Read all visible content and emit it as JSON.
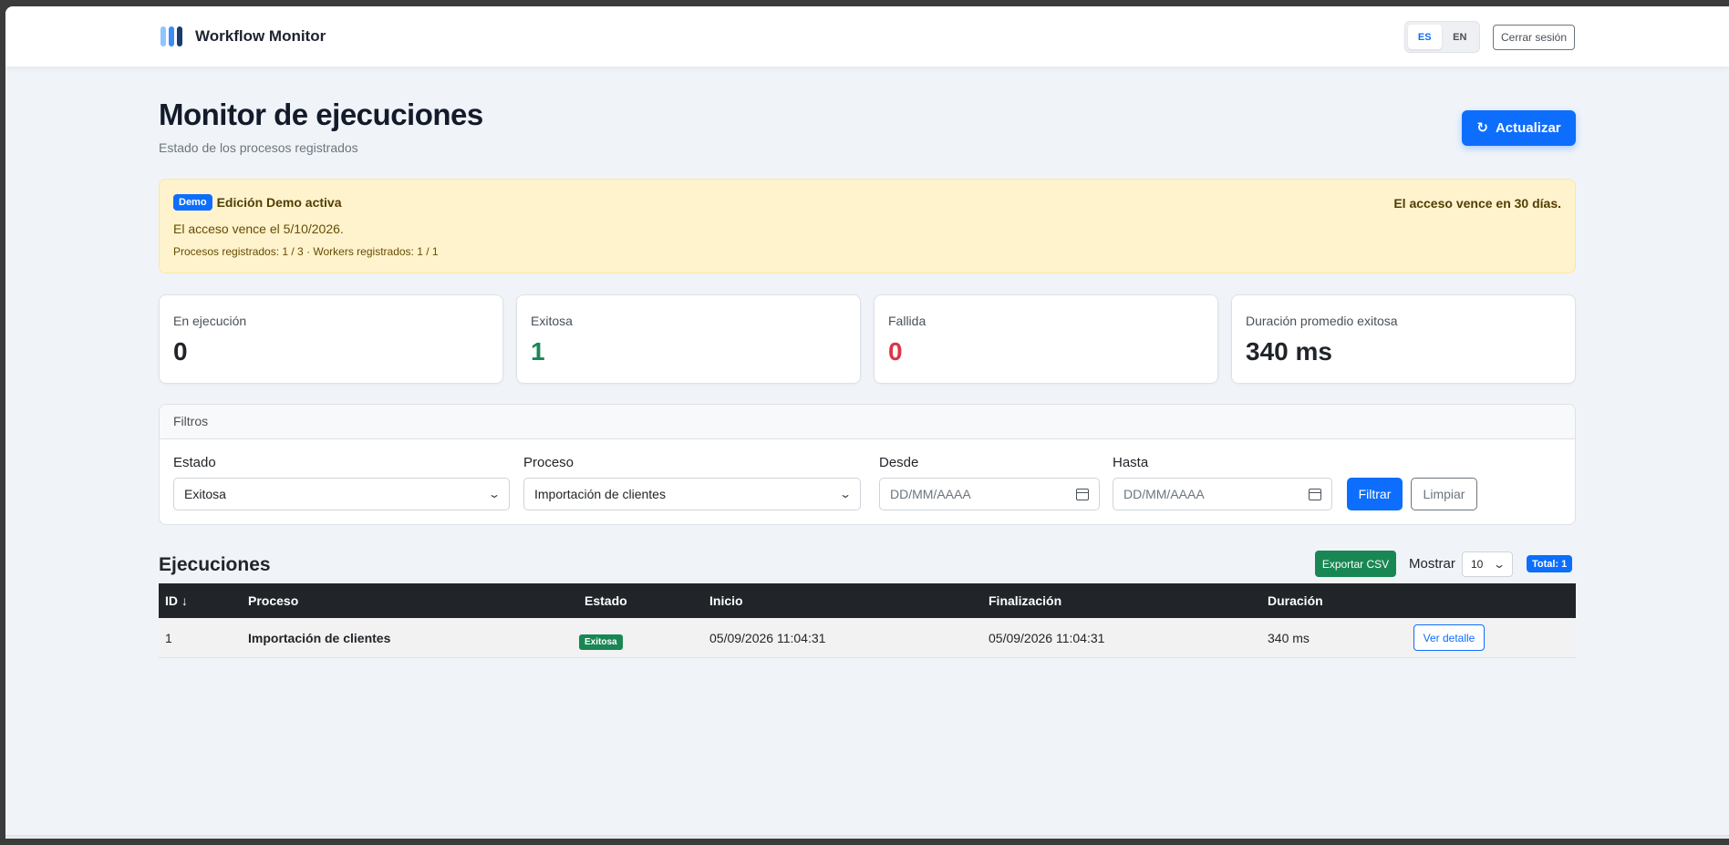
{
  "app": {
    "name": "Workflow Monitor"
  },
  "nav": {
    "languages": [
      {
        "code": "ES",
        "active": true
      },
      {
        "code": "EN",
        "active": false
      }
    ],
    "logout_label": "Cerrar sesión"
  },
  "page": {
    "title": "Monitor de ejecuciones",
    "subtitle": "Estado de los procesos registrados",
    "refresh_label": "Actualizar"
  },
  "demo": {
    "badge": "Demo",
    "title": "Edición Demo activa",
    "expires_in": "El acceso vence en 30 días.",
    "expiry_date_text": "El acceso vence el 5/10/2026.",
    "counts_text": "Procesos registrados: 1 / 3 · Workers registrados: 1 / 1"
  },
  "stats": [
    {
      "label": "En ejecución",
      "value": "0"
    },
    {
      "label": "Exitosa",
      "value": "1"
    },
    {
      "label": "Fallida",
      "value": "0"
    },
    {
      "label": "Duración promedio exitosa",
      "value": "340 ms"
    }
  ],
  "filters": {
    "header": "Filtros",
    "estado_label": "Estado",
    "estado_value": "Exitosa",
    "proceso_label": "Proceso",
    "proceso_value": "Importación de clientes",
    "desde_label": "Desde",
    "desde_placeholder": "DD/MM/AAAA",
    "hasta_label": "Hasta",
    "hasta_placeholder": "DD/MM/AAAA",
    "filter_label": "Filtrar",
    "clear_label": "Limpiar"
  },
  "executions": {
    "title": "Ejecuciones",
    "export_label": "Exportar CSV",
    "show_label": "Mostrar",
    "page_size": "10",
    "total_label": "Total: 1",
    "columns": [
      "ID ↓",
      "Proceso",
      "Estado",
      "Inicio",
      "Finalización",
      "Duración"
    ],
    "rows": [
      {
        "id": "1",
        "process": "Importación de clientes",
        "status": "Exitosa",
        "start": "05/09/2026 11:04:31",
        "end": "05/09/2026 11:04:31",
        "duration": "340 ms",
        "action": "Ver detalle"
      }
    ]
  },
  "colors": {
    "primary": "#0d6efd",
    "success": "#198754",
    "danger": "#dc3545",
    "warning_bg": "#fff3cd",
    "table_head": "#212529"
  }
}
